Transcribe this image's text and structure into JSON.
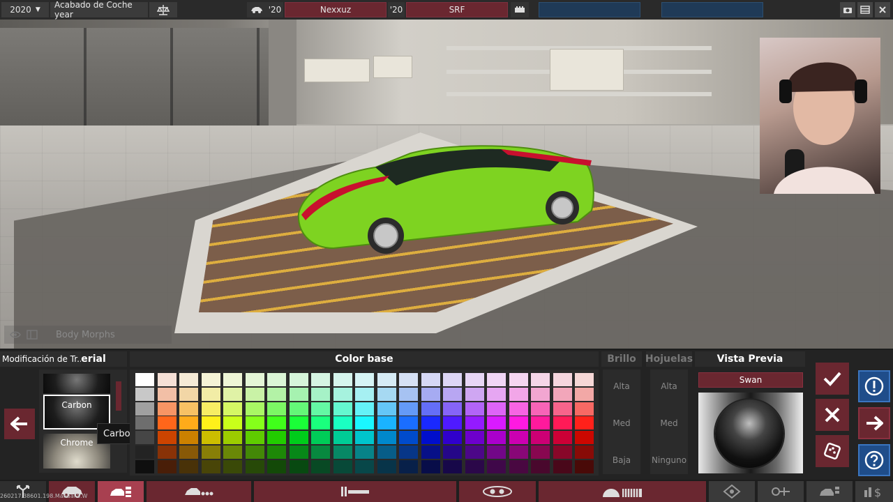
{
  "topbar": {
    "year": "2020",
    "title": "Acabado de Coche year",
    "model_year": "'20",
    "model_name": "Nexxuz",
    "trim_year": "'20",
    "trim_name": "SRF"
  },
  "body_morphs": {
    "label": "Body Morphs"
  },
  "panel": {
    "modifications_tab": "Modificación de Tr...",
    "material_header": "Material",
    "materials": [
      {
        "name": ""
      },
      {
        "name": "Carbon"
      },
      {
        "name": "Chrome"
      }
    ],
    "tooltip": "Carbon - Clic para opciones",
    "color_header": "Color base",
    "brillo": {
      "header": "Brillo",
      "options": [
        "Alta",
        "Med",
        "Baja"
      ]
    },
    "hojuelas": {
      "header": "Hojuelas",
      "options": [
        "Alta",
        "Med",
        "Ninguno"
      ]
    },
    "preview": {
      "header": "Vista Previa",
      "name": "Swan"
    }
  },
  "build_info": "260217.38601.198.Manual.V.W",
  "colors": {
    "accent_red": "#6a2730",
    "accent_blue": "#1f4d8a",
    "car_green": "#7ed321",
    "car_stripe": "#c8102e"
  }
}
